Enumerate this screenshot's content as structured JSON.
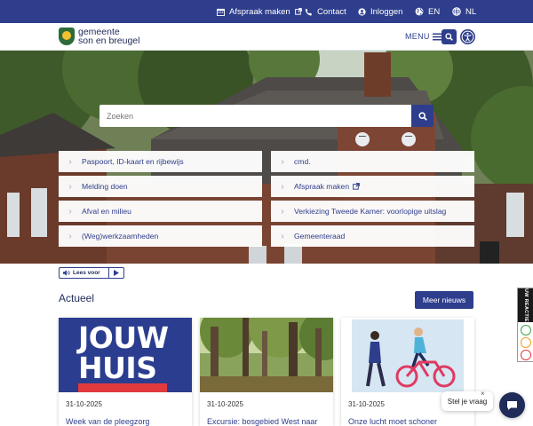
{
  "topbar": {
    "appointment": "Afspraak maken",
    "contact": "Contact",
    "login": "Inloggen",
    "lang_en": "EN",
    "lang_nl": "NL"
  },
  "header": {
    "logo_line1": "gemeente",
    "logo_line2": "son en breugel",
    "menu_label": "MENU"
  },
  "search": {
    "placeholder": "Zoeken"
  },
  "quick_links": {
    "left": [
      "Paspoort, ID-kaart en rijbewijs",
      "Melding doen",
      "Afval en milieu",
      "(Weg)werkzaamheden"
    ],
    "right": [
      "cmd.",
      "Afspraak maken",
      "Verkiezing Tweede Kamer: voorlopige uitslag",
      "Gemeenteraad"
    ]
  },
  "read_aloud": {
    "label": "Lees voor"
  },
  "news": {
    "section_title": "Actueel",
    "more_label": "Meer nieuws",
    "items": [
      {
        "date": "31-10-2025",
        "title": "Week van de pleegzorg",
        "image_text": [
          "JOUW",
          "HUIS"
        ]
      },
      {
        "date": "31-10-2025",
        "title": "Excursie: bosgebied West naar"
      },
      {
        "date": "31-10-2025",
        "title": "Onze lucht moet schoner"
      }
    ]
  },
  "feedback": {
    "label": "UW REACTIE"
  },
  "chat": {
    "bubble": "Stel je vraag",
    "close": "×"
  },
  "colors": {
    "primary": "#2e3e8c",
    "navy": "#1f2b59",
    "accent_red": "#e03a3e"
  }
}
